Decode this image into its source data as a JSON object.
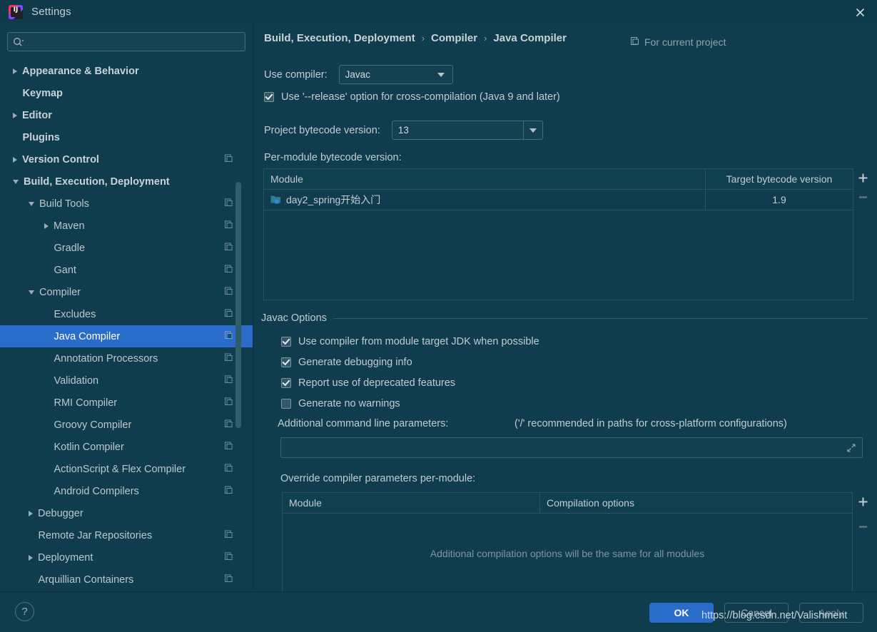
{
  "window": {
    "title": "Settings",
    "logo_icon": "intellij-idea-logo",
    "close_icon": "close-icon"
  },
  "sidebar": {
    "search": {
      "placeholder": "",
      "value": "",
      "icon": "search-icon",
      "dropdown_icon": "chevron-down-icon"
    },
    "items": [
      {
        "label": "Appearance & Behavior",
        "twisty": "right",
        "bold": true,
        "indent": 0,
        "copy": false,
        "selected": false
      },
      {
        "label": "Keymap",
        "twisty": "none",
        "bold": true,
        "indent": 0,
        "copy": false,
        "selected": false
      },
      {
        "label": "Editor",
        "twisty": "right",
        "bold": true,
        "indent": 0,
        "copy": false,
        "selected": false
      },
      {
        "label": "Plugins",
        "twisty": "none",
        "bold": true,
        "indent": 0,
        "copy": false,
        "selected": false
      },
      {
        "label": "Version Control",
        "twisty": "right",
        "bold": true,
        "indent": 0,
        "copy": true,
        "selected": false
      },
      {
        "label": "Build, Execution, Deployment",
        "twisty": "down",
        "bold": true,
        "indent": 0,
        "copy": false,
        "selected": false
      },
      {
        "label": "Build Tools",
        "twisty": "down",
        "bold": false,
        "indent": 1,
        "copy": true,
        "selected": false
      },
      {
        "label": "Maven",
        "twisty": "right",
        "bold": false,
        "indent": 2,
        "copy": true,
        "selected": false
      },
      {
        "label": "Gradle",
        "twisty": "none",
        "bold": false,
        "indent": 2,
        "copy": true,
        "selected": false
      },
      {
        "label": "Gant",
        "twisty": "none",
        "bold": false,
        "indent": 2,
        "copy": true,
        "selected": false
      },
      {
        "label": "Compiler",
        "twisty": "down",
        "bold": false,
        "indent": 1,
        "copy": true,
        "selected": false
      },
      {
        "label": "Excludes",
        "twisty": "none",
        "bold": false,
        "indent": 2,
        "copy": true,
        "selected": false
      },
      {
        "label": "Java Compiler",
        "twisty": "none",
        "bold": false,
        "indent": 2,
        "copy": true,
        "selected": true
      },
      {
        "label": "Annotation Processors",
        "twisty": "none",
        "bold": false,
        "indent": 2,
        "copy": true,
        "selected": false
      },
      {
        "label": "Validation",
        "twisty": "none",
        "bold": false,
        "indent": 2,
        "copy": true,
        "selected": false
      },
      {
        "label": "RMI Compiler",
        "twisty": "none",
        "bold": false,
        "indent": 2,
        "copy": true,
        "selected": false
      },
      {
        "label": "Groovy Compiler",
        "twisty": "none",
        "bold": false,
        "indent": 2,
        "copy": true,
        "selected": false
      },
      {
        "label": "Kotlin Compiler",
        "twisty": "none",
        "bold": false,
        "indent": 2,
        "copy": true,
        "selected": false
      },
      {
        "label": "ActionScript & Flex Compiler",
        "twisty": "none",
        "bold": false,
        "indent": 2,
        "copy": true,
        "selected": false
      },
      {
        "label": "Android Compilers",
        "twisty": "none",
        "bold": false,
        "indent": 2,
        "copy": true,
        "selected": false
      },
      {
        "label": "Debugger",
        "twisty": "right",
        "bold": false,
        "indent": 1,
        "copy": false,
        "selected": false
      },
      {
        "label": "Remote Jar Repositories",
        "twisty": "none",
        "bold": false,
        "indent": 1,
        "copy": true,
        "selected": false
      },
      {
        "label": "Deployment",
        "twisty": "right",
        "bold": false,
        "indent": 1,
        "copy": true,
        "selected": false
      },
      {
        "label": "Arquillian Containers",
        "twisty": "none",
        "bold": false,
        "indent": 1,
        "copy": true,
        "selected": false
      }
    ]
  },
  "panel": {
    "breadcrumb": [
      "Build, Execution, Deployment",
      "Compiler",
      "Java Compiler"
    ],
    "breadcrumb_separator": "›",
    "scope": {
      "label": "For current project",
      "icon": "copy-scope-icon"
    },
    "use_compiler": {
      "label": "Use compiler:",
      "value": "Javac"
    },
    "release_option": {
      "label": "Use '--release' option for cross-compilation (Java 9 and later)",
      "checked": true
    },
    "project_bytecode": {
      "label": "Project bytecode version:",
      "value": "13"
    },
    "per_module_label": "Per-module bytecode version:",
    "module_table": {
      "columns": [
        "Module",
        "Target bytecode version"
      ],
      "rows": [
        {
          "module": "day2_spring开始入门",
          "target": "1.9",
          "icon": "module-icon"
        }
      ],
      "add_label": "+",
      "remove_label": "−"
    },
    "javac_options": {
      "group_title": "Javac Options",
      "checkboxes": [
        {
          "label": "Use compiler from module target JDK when possible",
          "checked": true
        },
        {
          "label": "Generate debugging info",
          "checked": true
        },
        {
          "label": "Report use of deprecated features",
          "checked": true
        },
        {
          "label": "Generate no warnings",
          "checked": false
        }
      ],
      "additional_params_label": "Additional command line parameters:",
      "additional_params_hint": "('/' recommended in paths for cross-platform configurations)",
      "additional_params_value": "",
      "expand_icon": "expand-icon",
      "override_label": "Override compiler parameters per-module:",
      "override_table": {
        "columns": [
          "Module",
          "Compilation options"
        ],
        "empty_message": "Additional compilation options will be the same for all modules",
        "add_label": "+",
        "remove_label": "−"
      }
    }
  },
  "footer": {
    "help_label": "?",
    "ok_label": "OK",
    "cancel_label": "Cancel",
    "apply_label": "Apply"
  },
  "watermark": "https://blog.csdn.net/Valishment",
  "colors": {
    "background": "#0f3d4d",
    "titlebar": "#0e3a49",
    "accent": "#2a6cc9",
    "text": "#c3cdd1",
    "muted": "#8fa3ac",
    "border": "#2d5260"
  }
}
